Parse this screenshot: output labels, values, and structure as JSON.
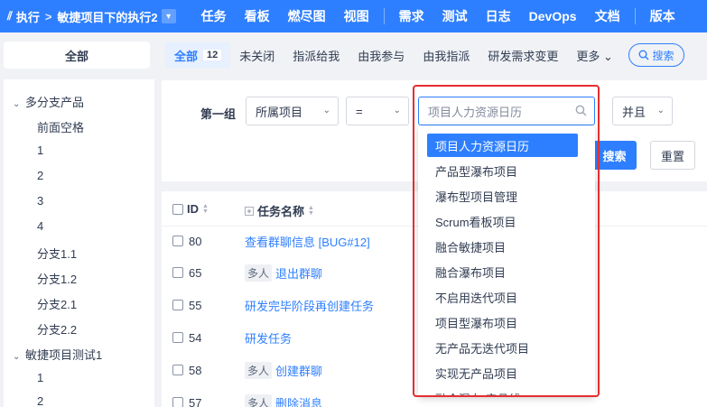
{
  "topnav": {
    "logo_glyph": "⫽",
    "section": "执行",
    "separator": ">",
    "project": "敏捷项目下的执行2",
    "dropdown_glyph": "▾",
    "items": [
      "任务",
      "看板",
      "燃尽图",
      "视图",
      "需求",
      "测试",
      "日志",
      "DevOps",
      "文档",
      "版本"
    ]
  },
  "left": {
    "all_label": "全部",
    "tree": [
      {
        "label": "多分支产品",
        "caret": "⌄",
        "level": 0
      },
      {
        "label": "前面空格",
        "level": 1
      },
      {
        "label": "1",
        "level": 1
      },
      {
        "label": "2",
        "level": 1
      },
      {
        "label": "3",
        "level": 1
      },
      {
        "label": "4",
        "level": 1
      },
      {
        "label": "分支1.1",
        "level": 1
      },
      {
        "label": "分支1.2",
        "level": 1
      },
      {
        "label": "分支2.1",
        "level": 1
      },
      {
        "label": "分支2.2",
        "level": 1
      },
      {
        "label": "敏捷项目测试1",
        "caret": "⌄",
        "level": 0
      },
      {
        "label": "1",
        "level": 1
      },
      {
        "label": "2",
        "level": 1
      }
    ]
  },
  "tabs": {
    "items": [
      {
        "label": "全部",
        "badge": "12",
        "active": true
      },
      {
        "label": "未关闭"
      },
      {
        "label": "指派给我"
      },
      {
        "label": "由我参与"
      },
      {
        "label": "由我指派"
      },
      {
        "label": "研发需求变更"
      },
      {
        "label": "更多 ⌄"
      }
    ],
    "search_label": "搜索"
  },
  "search_form": {
    "group_label": "第一组",
    "field_value": "所属项目",
    "operator_value": "=",
    "value_placeholder": "项目人力资源日历",
    "logic_value": "并且",
    "search_button": "搜索",
    "reset_button": "重置"
  },
  "table": {
    "columns": [
      "ID",
      "任务名称"
    ],
    "rows": [
      {
        "id": "80",
        "tag": "",
        "name": "查看群聊信息 [BUG#12]"
      },
      {
        "id": "65",
        "tag": "多人",
        "name": "退出群聊"
      },
      {
        "id": "55",
        "tag": "",
        "name": "研发完毕阶段再创建任务"
      },
      {
        "id": "54",
        "tag": "",
        "name": "研发任务"
      },
      {
        "id": "58",
        "tag": "多人",
        "name": "创建群聊"
      },
      {
        "id": "57",
        "tag": "多人",
        "name": "删除消息"
      }
    ]
  },
  "dropdown": {
    "options": [
      "项目人力资源日历",
      "产品型瀑布项目",
      "瀑布型项目管理",
      "Scrum看板项目",
      "融合敏捷项目",
      "融合瀑布项目",
      "不启用迭代项目",
      "项目型瀑布项目",
      "无产品无迭代项目",
      "实现无产品项目",
      "融合瀑布 产品线"
    ],
    "selected_index": 0
  },
  "colors": {
    "primary": "#2e7fff",
    "highlight": "#e62e2e"
  }
}
